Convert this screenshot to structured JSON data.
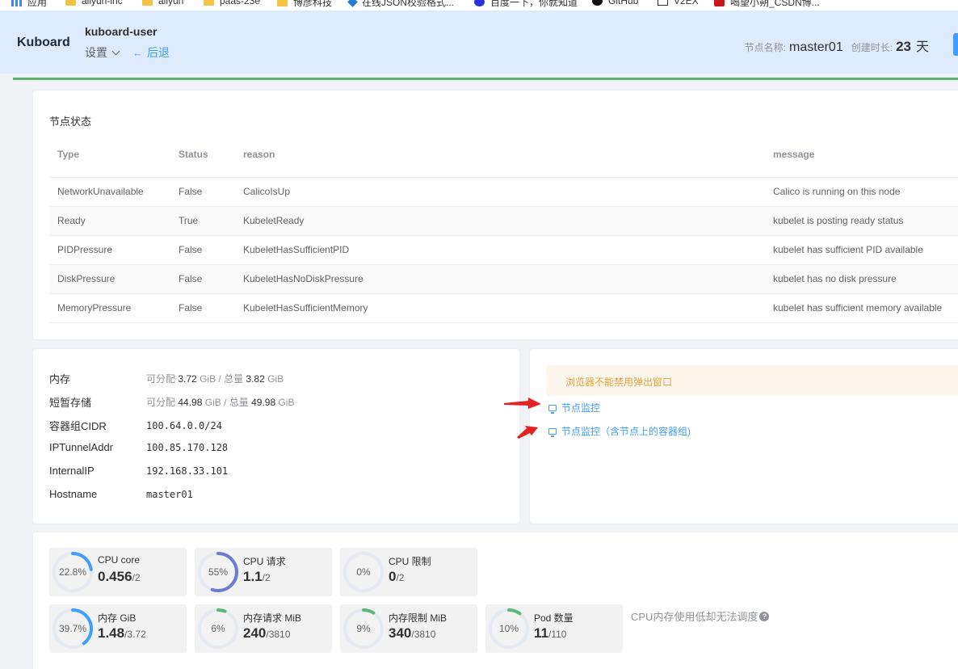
{
  "bookmarks": [
    {
      "label": "应用",
      "icon": "apps-icon"
    },
    {
      "label": "aliyun-inc",
      "icon": "folder-icon"
    },
    {
      "label": "aliyun",
      "icon": "folder-icon"
    },
    {
      "label": "paas-23e",
      "icon": "folder-icon"
    },
    {
      "label": "博彦科技",
      "icon": "folder-icon"
    },
    {
      "label": "在线JSON校验格式...",
      "icon": "json-icon"
    },
    {
      "label": "百度一下，你就知道",
      "icon": "baidu-icon"
    },
    {
      "label": "GitHub",
      "icon": "github-icon"
    },
    {
      "label": "V2EX",
      "icon": "v2ex-icon"
    },
    {
      "label": "喝望小朔_CSDN博...",
      "icon": "csdn-icon"
    }
  ],
  "header": {
    "brand": "Kuboard",
    "namespace": "kuboard-user",
    "settings_label": "设置",
    "back_label": "后退",
    "node_name_label": "节点名称:",
    "node_name": "master01",
    "uptime_label": "创建时长:",
    "uptime_value": "23",
    "uptime_unit": "天"
  },
  "status": {
    "title": "节点状态",
    "columns": [
      "Type",
      "Status",
      "reason",
      "message"
    ],
    "rows": [
      [
        "NetworkUnavailable",
        "False",
        "CalicoIsUp",
        "Calico is running on this node"
      ],
      [
        "Ready",
        "True",
        "KubeletReady",
        "kubelet is posting ready status"
      ],
      [
        "PIDPressure",
        "False",
        "KubeletHasSufficientPID",
        "kubelet has sufficient PID available"
      ],
      [
        "DiskPressure",
        "False",
        "KubeletHasNoDiskPressure",
        "kubelet has no disk pressure"
      ],
      [
        "MemoryPressure",
        "False",
        "KubeletHasSufficientMemory",
        "kubelet has sufficient memory available"
      ]
    ]
  },
  "info": {
    "memory_label": "内存",
    "memory_alloc_prefix": "可分配",
    "memory_alloc": "3.72",
    "memory_unit1": "GiB / 总量",
    "memory_total": "3.82",
    "memory_unit2": "GiB",
    "storage_label": "短暂存储",
    "storage_alloc_prefix": "可分配",
    "storage_alloc": "44.98",
    "storage_unit1": "GiB / 总量",
    "storage_total": "49.98",
    "storage_unit2": "GiB",
    "cidr_label": "容器组CIDR",
    "cidr": "100.64.0.0/24",
    "tunnel_label": "IPTunnelAddr",
    "tunnel": "100.85.170.128",
    "ip_label": "InternalIP",
    "ip": "192.168.33.101",
    "hostname_label": "Hostname",
    "hostname": "master01"
  },
  "monitor": {
    "warning": "浏览器不能禁用弹出窗口",
    "link1": "节点监控",
    "link2": "节点监控（含节点上的容器组)"
  },
  "metrics": [
    {
      "name": "CPU core",
      "percent_text": "22.8%",
      "value": "0.456",
      "total": "/2",
      "fraction": 0.228,
      "color": "#409eff"
    },
    {
      "name": "CPU 请求",
      "percent_text": "55%",
      "value": "1.1",
      "total": "/2",
      "fraction": 0.55,
      "color": "#6f7ad3"
    },
    {
      "name": "CPU 限制",
      "percent_text": "0%",
      "value": "0",
      "total": "/2",
      "fraction": 0,
      "color": "#5cb87a"
    },
    {
      "name": "内存 GiB",
      "percent_text": "39.7%",
      "value": "1.48",
      "total": "/3.72",
      "fraction": 0.397,
      "color": "#409eff"
    },
    {
      "name": "内存请求 MiB",
      "percent_text": "6%",
      "value": "240",
      "total": "/3810",
      "fraction": 0.06,
      "color": "#5cb87a"
    },
    {
      "name": "内存限制 MiB",
      "percent_text": "9%",
      "value": "340",
      "total": "/3810",
      "fraction": 0.09,
      "color": "#5cb87a"
    },
    {
      "name": "Pod 数量",
      "percent_text": "10%",
      "value": "11",
      "total": "/110",
      "fraction": 0.1,
      "color": "#5cb87a"
    }
  ],
  "metrics_note": "CPU内存使用低却无法调度"
}
